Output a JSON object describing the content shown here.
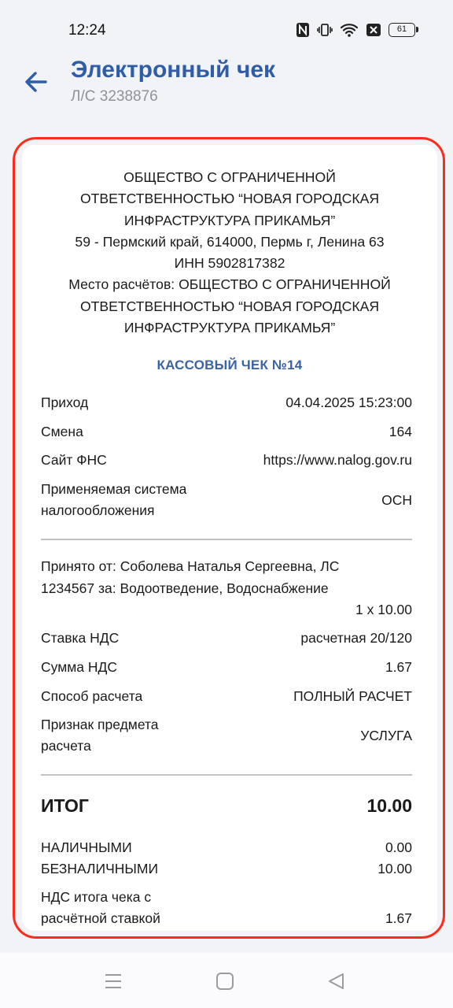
{
  "status_bar": {
    "time": "12:24",
    "battery": "61",
    "icons": [
      "nfc-icon",
      "vibrate-icon",
      "wifi-icon",
      "no-sim-icon",
      "battery-icon"
    ]
  },
  "header": {
    "title": "Электронный чек",
    "subtitle": "Л/С 3238876"
  },
  "receipt": {
    "org_lines": [
      "ОБЩЕСТВО С ОГРАНИЧЕННОЙ",
      "ОТВЕТСТВЕННОСТЬЮ “НОВАЯ ГОРОДСКАЯ",
      "ИНФРАСТРУКТУРА ПРИКАМЬЯ”",
      "59 - Пермский край, 614000, Пермь г, Ленина 63",
      "ИНН 5902817382",
      "Место расчётов: ОБЩЕСТВО С ОГРАНИЧЕННОЙ",
      "ОТВЕТСТВЕННОСТЬЮ “НОВАЯ ГОРОДСКАЯ",
      "ИНФРАСТРУКТУРА ПРИКАМЬЯ”"
    ],
    "check_title": "КАССОВЫЙ ЧЕК №14",
    "info_rows": [
      {
        "label": "Приход",
        "value": "04.04.2025 15:23:00"
      },
      {
        "label": "Смена",
        "value": "164"
      },
      {
        "label": "Сайт ФНС",
        "value": "https://www.nalog.gov.ru"
      },
      {
        "label_line1": "Применяемая система",
        "label_line2": "налогообложения",
        "value": "ОСН"
      }
    ],
    "item": {
      "line1": "Принято от: Соболева Наталья Сергеевна, ЛС",
      "line2": "1234567 за: Водоотведение, Водоснабжение",
      "qty": "1 x 10.00"
    },
    "item_rows": [
      {
        "label": "Ставка НДС",
        "value": "расчетная 20/120"
      },
      {
        "label": "Сумма НДС",
        "value": "1.67"
      },
      {
        "label": "Способ расчета",
        "value": "ПОЛНЫЙ РАСЧЕТ"
      },
      {
        "label_line1": "Признак предмета",
        "label_line2": "расчета",
        "value": "УСЛУГА"
      }
    ],
    "total": {
      "label": "ИТОГ",
      "value": "10.00"
    },
    "payments": [
      {
        "label": "НАЛИЧНЫМИ",
        "value": "0.00"
      },
      {
        "label": "БЕЗНАЛИЧНЫМИ",
        "value": "10.00"
      }
    ],
    "vat_total": {
      "label_line1": "НДС итога чека с",
      "label_line2": "расчётной ставкой",
      "value": "1.67"
    }
  },
  "nav_bar": {
    "icons": [
      "menu-icon",
      "home-icon",
      "back-triangle-icon"
    ]
  },
  "colors": {
    "accent": "#2f5da8",
    "highlight": "#ff2b1c",
    "background": "#f2f3f7"
  }
}
